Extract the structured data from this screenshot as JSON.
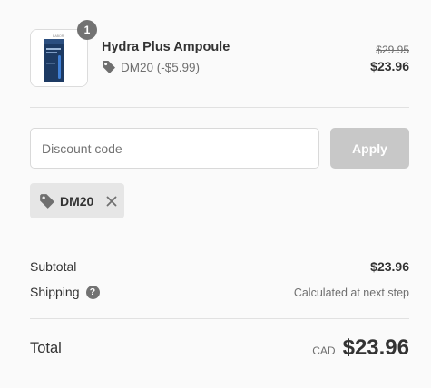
{
  "product": {
    "quantity": "1",
    "name": "Hydra Plus Ampoule",
    "discount": "DM20 (-$5.99)",
    "original_price": "$29.95",
    "price": "$23.96",
    "thumbnail_icon": "ampoule-product-image"
  },
  "discount_form": {
    "placeholder": "Discount code",
    "apply_label": "Apply"
  },
  "applied_code": {
    "code": "DM20",
    "tag_icon": "tag-icon",
    "remove_icon": "close-icon"
  },
  "totals": {
    "subtotal_label": "Subtotal",
    "subtotal_value": "$23.96",
    "shipping_label": "Shipping",
    "shipping_help": "?",
    "shipping_value": "Calculated at next step",
    "total_label": "Total",
    "currency": "CAD",
    "total_value": "$23.96"
  },
  "colors": {
    "text": "#333333",
    "muted": "#6f6f6f",
    "badge": "#727272",
    "apply_disabled": "#c8c8c8",
    "chip_bg": "#e6e6e6",
    "divider": "#e1e1e1"
  }
}
